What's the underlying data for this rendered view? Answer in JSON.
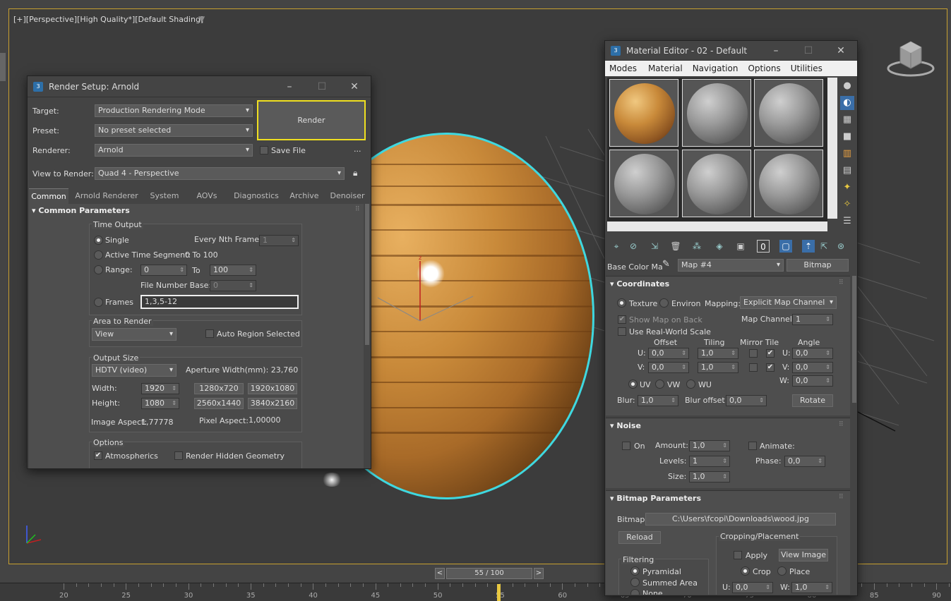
{
  "viewport": {
    "label": "[+][Perspective][High Quality*][Default Shading]",
    "timeline": {
      "frame_display": "55 / 100",
      "prev": "<",
      "next": ">",
      "progress": 0.55
    },
    "ruler_ticks": [
      "20",
      "25",
      "30",
      "35",
      "40",
      "45",
      "50",
      "55",
      "60",
      "65",
      "70",
      "75",
      "80",
      "85",
      "90"
    ],
    "icons": [
      "filter-icon",
      "view-cube-icon",
      "axis-tripod-icon",
      "transform-gizmo-icon"
    ]
  },
  "render_setup": {
    "title": "Render Setup: Arnold",
    "target_label": "Target:",
    "target_value": "Production Rendering Mode",
    "preset_label": "Preset:",
    "preset_value": "No preset selected",
    "renderer_label": "Renderer:",
    "renderer_value": "Arnold",
    "save_file_label": "Save File",
    "more_label": "...",
    "view_label": "View to Render:",
    "view_value": "Quad 4 - Perspective",
    "render_button": "Render",
    "tabs": [
      "Common",
      "Arnold Renderer",
      "System",
      "AOVs",
      "Diagnostics",
      "Archive",
      "Denoiser"
    ],
    "rollout_title": "Common Parameters",
    "time_output": {
      "title": "Time Output",
      "single": "Single",
      "every_nth": "Every Nth Frame:",
      "every_nth_value": "1",
      "active_segment": "Active Time Segment:",
      "active_range": "0 To 100",
      "range": "Range:",
      "range_from": "0",
      "to": "To",
      "range_to": "100",
      "file_number_base": "File Number Base:",
      "file_number_value": "0",
      "frames": "Frames",
      "frames_value": "1,3,5-12"
    },
    "area": {
      "title": "Area to Render",
      "value": "View",
      "auto_region": "Auto Region Selected"
    },
    "output_size": {
      "title": "Output Size",
      "preset": "HDTV (video)",
      "aperture": "Aperture Width(mm): 23,760",
      "width_label": "Width:",
      "width": "1920",
      "height_label": "Height:",
      "height": "1080",
      "presets": [
        "1280x720",
        "1920x1080",
        "2560x1440",
        "3840x2160"
      ],
      "image_aspect": "Image Aspect:",
      "image_aspect_value": "1,77778",
      "pixel_aspect": "Pixel Aspect:",
      "pixel_aspect_value": "1,00000"
    },
    "options": {
      "title": "Options",
      "atmospherics": "Atmospherics",
      "render_hidden": "Render Hidden Geometry"
    }
  },
  "material_editor": {
    "title": "Material Editor - 02 - Default",
    "menus": [
      "Modes",
      "Material",
      "Navigation",
      "Options",
      "Utilities"
    ],
    "map_label": "Base Color Ma",
    "map_name": "Map #4",
    "map_type": "Bitmap",
    "coordinates": {
      "title": "Coordinates",
      "texture": "Texture",
      "environ": "Environ",
      "mapping_label": "Mapping:",
      "mapping_value": "Explicit Map Channel",
      "show_map_on_back": "Show Map on Back",
      "map_channel_label": "Map Channel:",
      "map_channel_value": "1",
      "real_world": "Use Real-World Scale",
      "col_offset": "Offset",
      "col_tiling": "Tiling",
      "col_mirror": "Mirror Tile",
      "col_angle": "Angle",
      "u_label": "U:",
      "v_label": "V:",
      "w_label": "W:",
      "u_offset": "0,0",
      "v_offset": "0,0",
      "u_tiling": "1,0",
      "v_tiling": "1,0",
      "u_angle": "0,0",
      "v_angle": "0,0",
      "w_angle": "0,0",
      "uv": "UV",
      "vw": "VW",
      "wu": "WU",
      "blur_label": "Blur:",
      "blur_value": "1,0",
      "blur_offset_label": "Blur offset:",
      "blur_offset_value": "0,0",
      "rotate": "Rotate"
    },
    "noise": {
      "title": "Noise",
      "on": "On",
      "amount_label": "Amount:",
      "amount": "1,0",
      "animate": "Animate:",
      "levels_label": "Levels:",
      "levels": "1",
      "phase_label": "Phase:",
      "phase": "0,0",
      "size_label": "Size:",
      "size": "1,0"
    },
    "bitmap": {
      "title": "Bitmap Parameters",
      "bitmap_label": "Bitmap:",
      "path": "C:\\Users\\fcopi\\Downloads\\wood.jpg",
      "reload": "Reload",
      "cropping_title": "Cropping/Placement",
      "apply": "Apply",
      "view_image": "View Image",
      "crop": "Crop",
      "place": "Place",
      "u_label": "U:",
      "u_value": "0,0",
      "w_label": "W:",
      "w_value": "1,0",
      "filtering_title": "Filtering",
      "pyramidal": "Pyramidal",
      "summed_area": "Summed Area",
      "none": "None"
    }
  }
}
